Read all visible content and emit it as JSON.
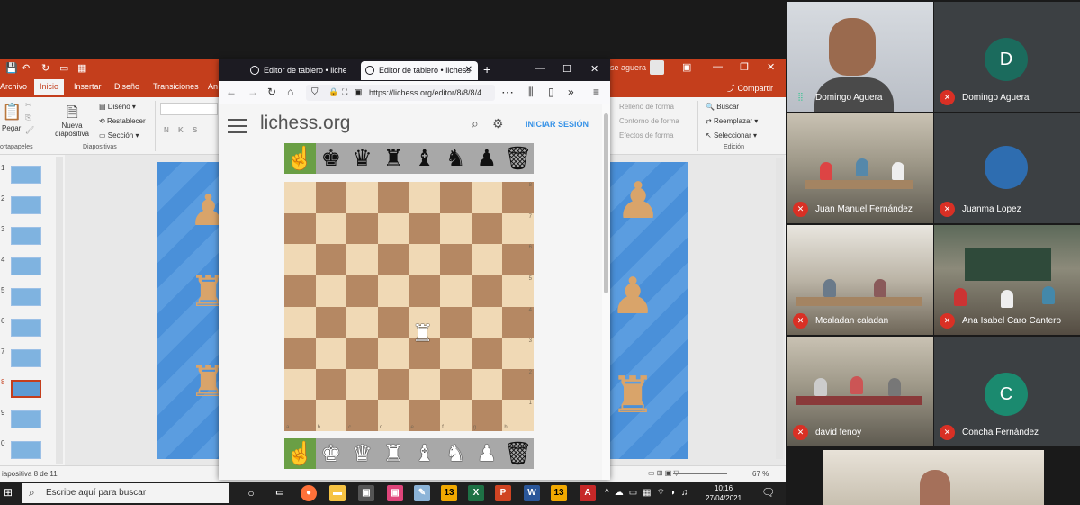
{
  "ppt": {
    "tabs": [
      "Archivo",
      "Inicio",
      "Insertar",
      "Diseño",
      "Transiciones",
      "An"
    ],
    "user_partial": "se aguera",
    "share_label": "Compartir",
    "ribbon": {
      "paste": "Pegar",
      "new_slide": "Nueva diapositiva",
      "layout": "Diseño",
      "reset": "Restablecer",
      "section": "Sección",
      "format_chars": "N K S",
      "group_clipboard": "ortapapeles",
      "group_slides": "Diapositivas",
      "shape_fill": "Relleno de forma",
      "shape_outline": "Contorno de forma",
      "shape_effects": "Efectos de forma",
      "find": "Buscar",
      "replace": "Reemplazar",
      "select": "Seleccionar",
      "group_edit": "Edición"
    },
    "thumb_numbers": [
      "1",
      "2",
      "3",
      "4",
      "5",
      "6",
      "7",
      "8",
      "9",
      "0"
    ],
    "status": "iapositiva 8 de 11",
    "zoom": "67 %"
  },
  "browser": {
    "tab1": "Editor de tablero • lichess",
    "tab2": "Editor de tablero • lichess",
    "url": "https://lichess.org/editor/8/8/8/4",
    "logo": "lichess.org",
    "login": "INICIAR SESIÓN",
    "files": [
      "a",
      "b",
      "c",
      "d",
      "e",
      "f",
      "g",
      "h"
    ],
    "ranks": [
      "8",
      "7",
      "6",
      "5",
      "4",
      "3",
      "2",
      "1"
    ]
  },
  "meeting": {
    "participants": [
      {
        "name": "Domingo Aguera",
        "mic": "on"
      },
      {
        "name": "Domingo Aguera",
        "initial": "D",
        "mic": "muted"
      },
      {
        "name": "Juan Manuel Fernández",
        "mic": "muted"
      },
      {
        "name": "Juanma Lopez",
        "mic": "muted"
      },
      {
        "name": "Mcaladan caladan",
        "mic": "muted"
      },
      {
        "name": "Ana Isabel Caro Cantero",
        "mic": "muted"
      },
      {
        "name": "david fenoy",
        "mic": "muted"
      },
      {
        "name": "Concha Fernández",
        "initial": "C",
        "mic": "muted"
      }
    ],
    "colors": {
      "avatar_d": "#1b6b5d",
      "avatar_c": "#1b8a6f",
      "muted_mic": "#d93025"
    }
  },
  "taskbar": {
    "search_placeholder": "Escribe aquí para buscar",
    "time": "10:16",
    "date": "27/04/2021"
  }
}
